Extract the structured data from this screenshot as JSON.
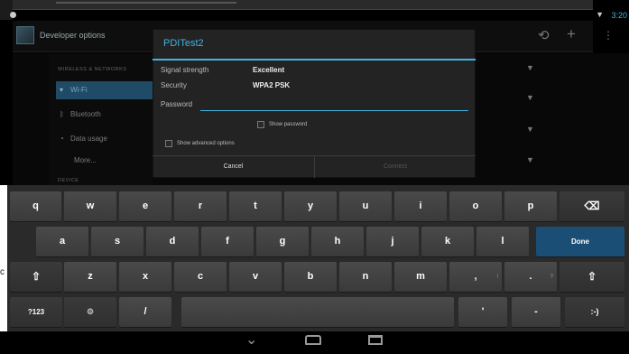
{
  "status_bar": {
    "time": "3:20",
    "wifi_icon": "wifi-signal-icon",
    "notification_icon": "notification-dot-icon"
  },
  "action_bar": {
    "title": "Developer options",
    "icons": [
      "sync-icon",
      "add-icon",
      "overflow-menu-icon"
    ]
  },
  "settings": {
    "section_wireless": "WIRELESS & NETWORKS",
    "items": [
      {
        "label": "Wi-Fi",
        "icon": "wifi-icon",
        "selected": true
      },
      {
        "label": "Bluetooth",
        "icon": "bluetooth-icon",
        "selected": false
      },
      {
        "label": "Data usage",
        "icon": "data-usage-icon",
        "selected": false
      },
      {
        "label": "More...",
        "icon": "",
        "selected": false
      }
    ],
    "section_device": "DEVICE"
  },
  "dialog": {
    "title": "PDITest2",
    "signal_label": "Signal strength",
    "signal_value": "Excellent",
    "security_label": "Security",
    "security_value": "WPA2 PSK",
    "password_label": "Password",
    "password_value": "",
    "show_password_label": "Show password",
    "show_advanced_label": "Show advanced options",
    "cancel_label": "Cancel",
    "connect_label": "Connect"
  },
  "keyboard": {
    "row1": [
      {
        "label": "q",
        "hint": ""
      },
      {
        "label": "w",
        "hint": ""
      },
      {
        "label": "e",
        "hint": ""
      },
      {
        "label": "r",
        "hint": ""
      },
      {
        "label": "t",
        "hint": ""
      },
      {
        "label": "y",
        "hint": ""
      },
      {
        "label": "u",
        "hint": ""
      },
      {
        "label": "i",
        "hint": ""
      },
      {
        "label": "o",
        "hint": ""
      },
      {
        "label": "p",
        "hint": ""
      }
    ],
    "row2": [
      {
        "label": "a"
      },
      {
        "label": "s"
      },
      {
        "label": "d"
      },
      {
        "label": "f"
      },
      {
        "label": "g"
      },
      {
        "label": "h"
      },
      {
        "label": "j"
      },
      {
        "label": "k"
      },
      {
        "label": "l"
      }
    ],
    "row3": [
      {
        "label": "z"
      },
      {
        "label": "x"
      },
      {
        "label": "c"
      },
      {
        "label": "v"
      },
      {
        "label": "b"
      },
      {
        "label": "n"
      },
      {
        "label": "m"
      },
      {
        "label": ",",
        "hint": "!"
      },
      {
        "label": ".",
        "hint": "?"
      }
    ],
    "backspace_icon": "backspace-icon",
    "done_label": "Done",
    "shift_icon": "shift-icon",
    "symbols_label": "?123",
    "settings_label": "⚙",
    "slash_label": "/",
    "apostrophe_label": "'",
    "dash_label": "-",
    "smiley_label": ":-)"
  },
  "nav_bar": {
    "back_icon": "back-icon",
    "home_icon": "home-icon",
    "recents_icon": "recents-icon"
  },
  "edge_fragment": "c"
}
